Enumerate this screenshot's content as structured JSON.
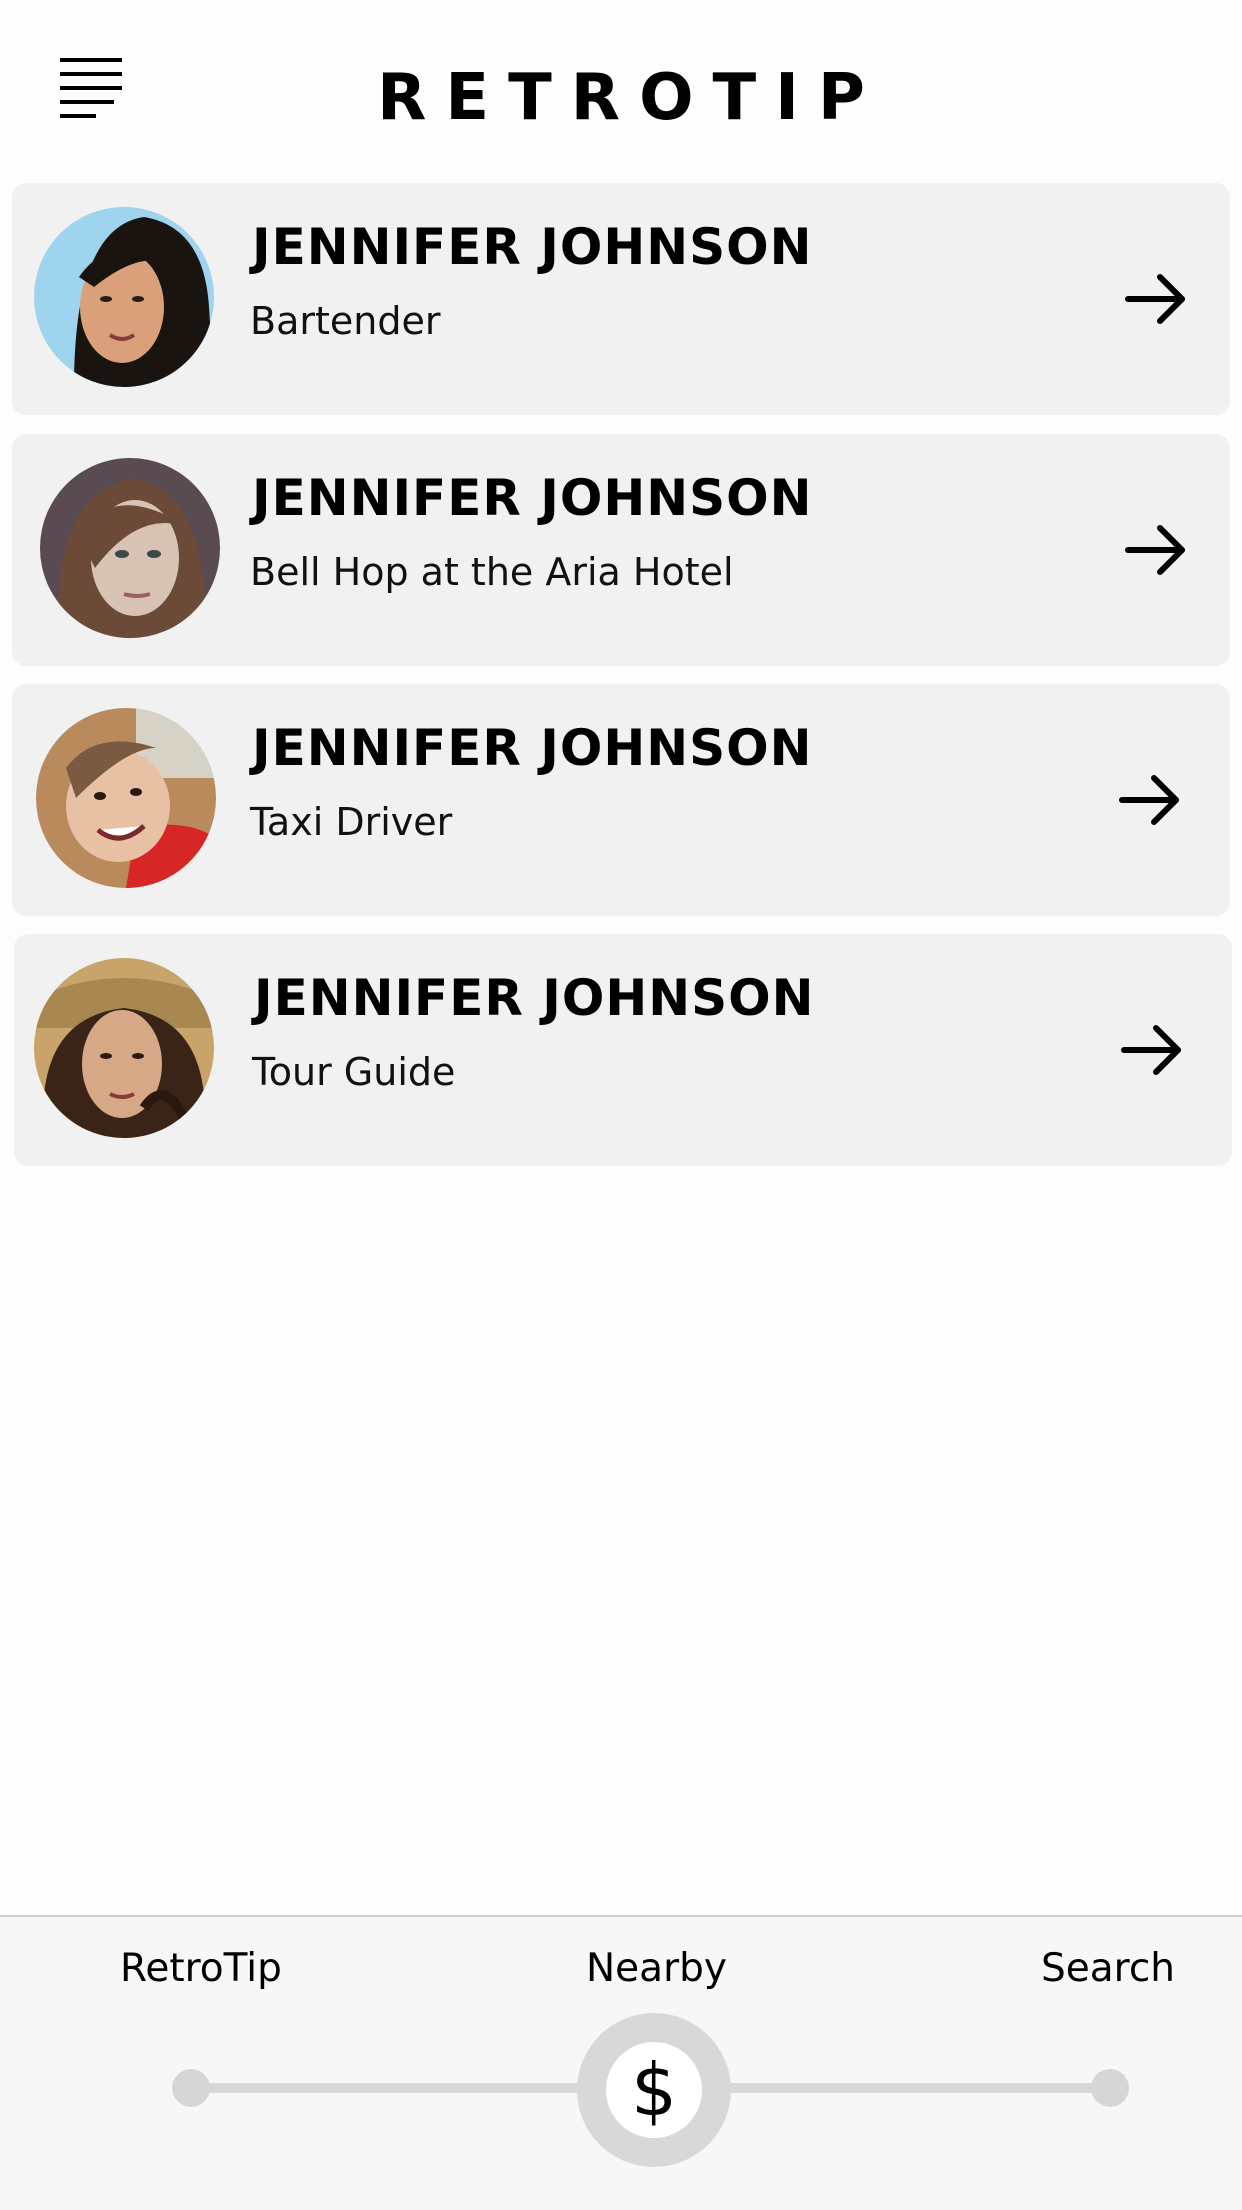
{
  "header": {
    "title": "RETROTIP",
    "menu_icon": "hamburger-menu-icon"
  },
  "list": {
    "items": [
      {
        "name": "JENNIFER JOHNSON",
        "role": "Bartender",
        "avatar_icon": "profile-photo",
        "arrow_icon": "arrow-right-icon",
        "avatar_bg": "#9fd4ee",
        "avatar_skin": "#d9a07a",
        "avatar_hair": "#1a1410"
      },
      {
        "name": "JENNIFER JOHNSON",
        "role": "Bell Hop at the Aria Hotel",
        "avatar_icon": "profile-photo",
        "arrow_icon": "arrow-right-icon",
        "avatar_bg": "#5a4a52",
        "avatar_skin": "#d8c2b4",
        "avatar_hair": "#6b4a38"
      },
      {
        "name": "JENNIFER JOHNSON",
        "role": "Taxi Driver",
        "avatar_icon": "profile-photo",
        "arrow_icon": "arrow-right-icon",
        "avatar_bg": "#b88a5c",
        "avatar_skin": "#e8c0a4",
        "avatar_hair": "#d62626"
      },
      {
        "name": "JENNIFER JOHNSON",
        "role": "Tour Guide",
        "avatar_icon": "profile-photo",
        "arrow_icon": "arrow-right-icon",
        "avatar_bg": "#c9a46a",
        "avatar_skin": "#d7a885",
        "avatar_hair": "#3a2418"
      }
    ]
  },
  "bottom_nav": {
    "labels": {
      "retrotip": "RetroTip",
      "nearby": "Nearby",
      "search": "Search"
    },
    "selected": "Nearby",
    "thumb_symbol": "$",
    "thumb_icon": "dollar-icon"
  },
  "colors": {
    "card_background": "#f1f1f1",
    "slider": "#d8d8d8",
    "text": "#000000"
  }
}
